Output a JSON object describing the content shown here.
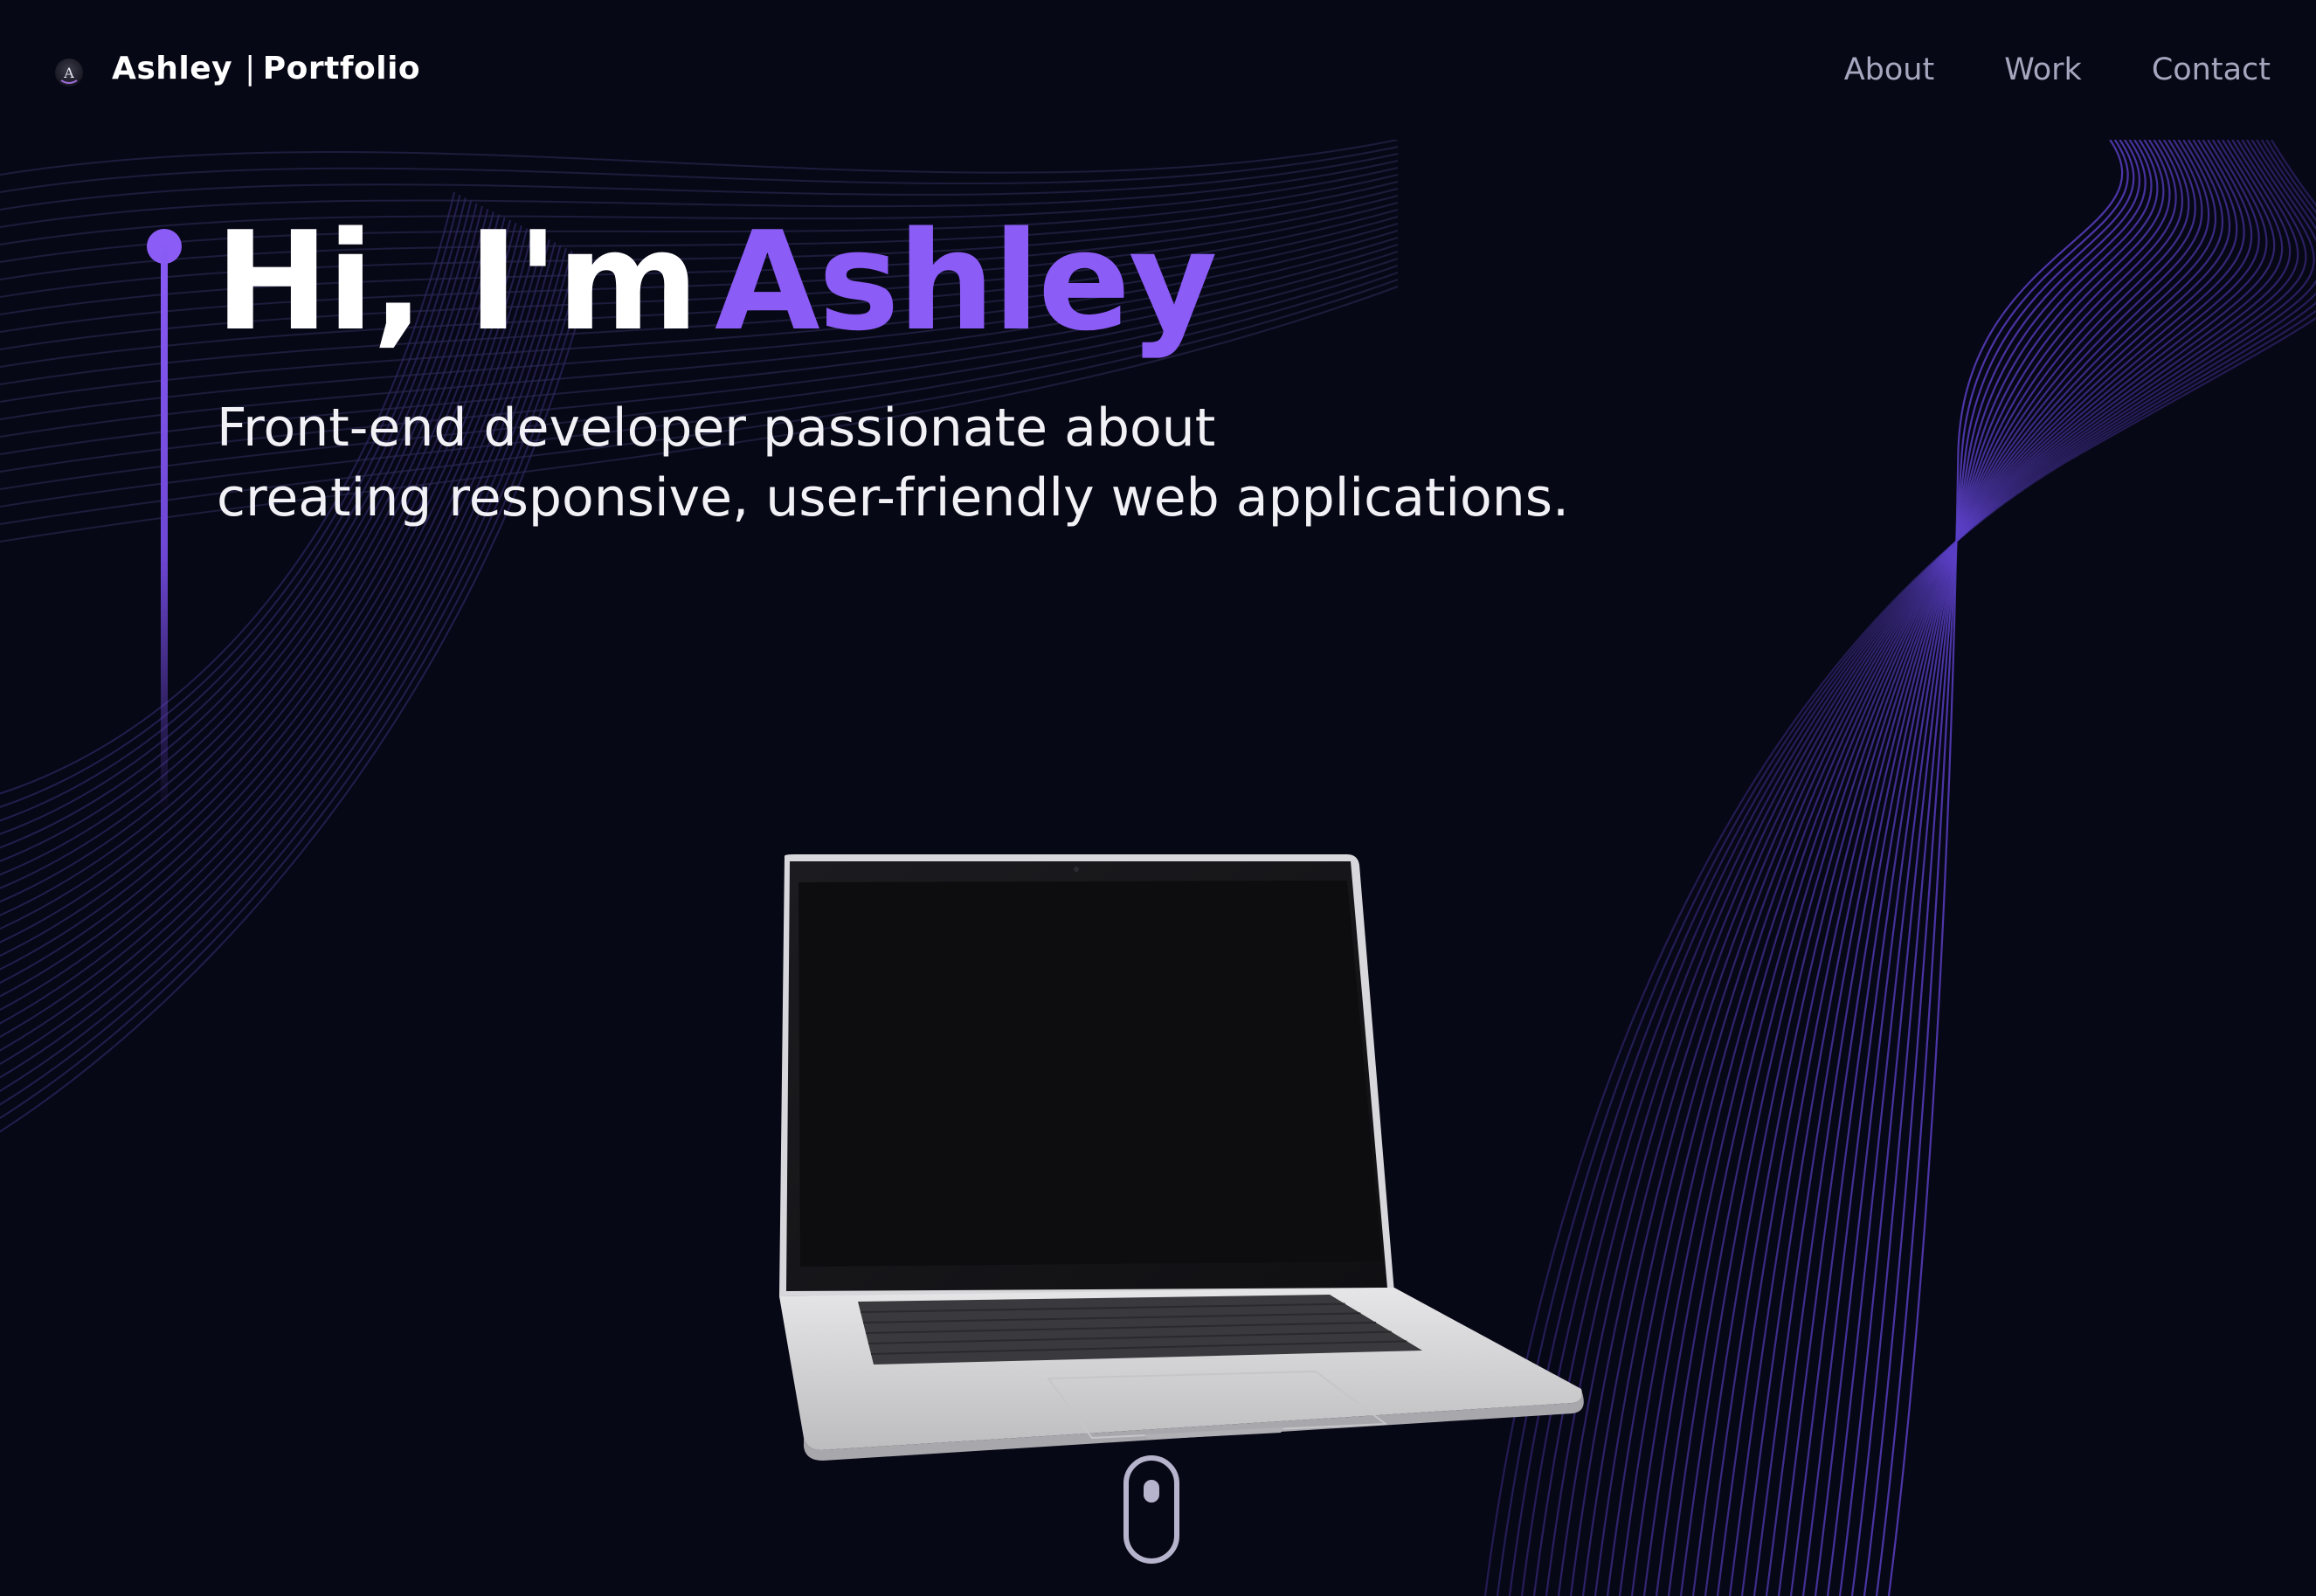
{
  "header": {
    "logo_icon": "a-letter-logo-icon",
    "brand_name": "Ashley",
    "brand_separator": "|",
    "brand_suffix": "Portfolio",
    "nav": [
      {
        "label": "About"
      },
      {
        "label": "Work"
      },
      {
        "label": "Contact"
      }
    ]
  },
  "hero": {
    "greeting": "Hi, I'm",
    "name": "Ashley",
    "subtitle_line1": "Front-end developer passionate about",
    "subtitle_line2": "creating responsive, user-friendly web applications."
  },
  "scroll_indicator": {
    "icon": "mouse-scroll-icon"
  },
  "colors": {
    "background": "#070816",
    "accent": "#8b5cf6",
    "nav_text": "#a7a6bf",
    "wave_lines": "#5a3fc4"
  }
}
